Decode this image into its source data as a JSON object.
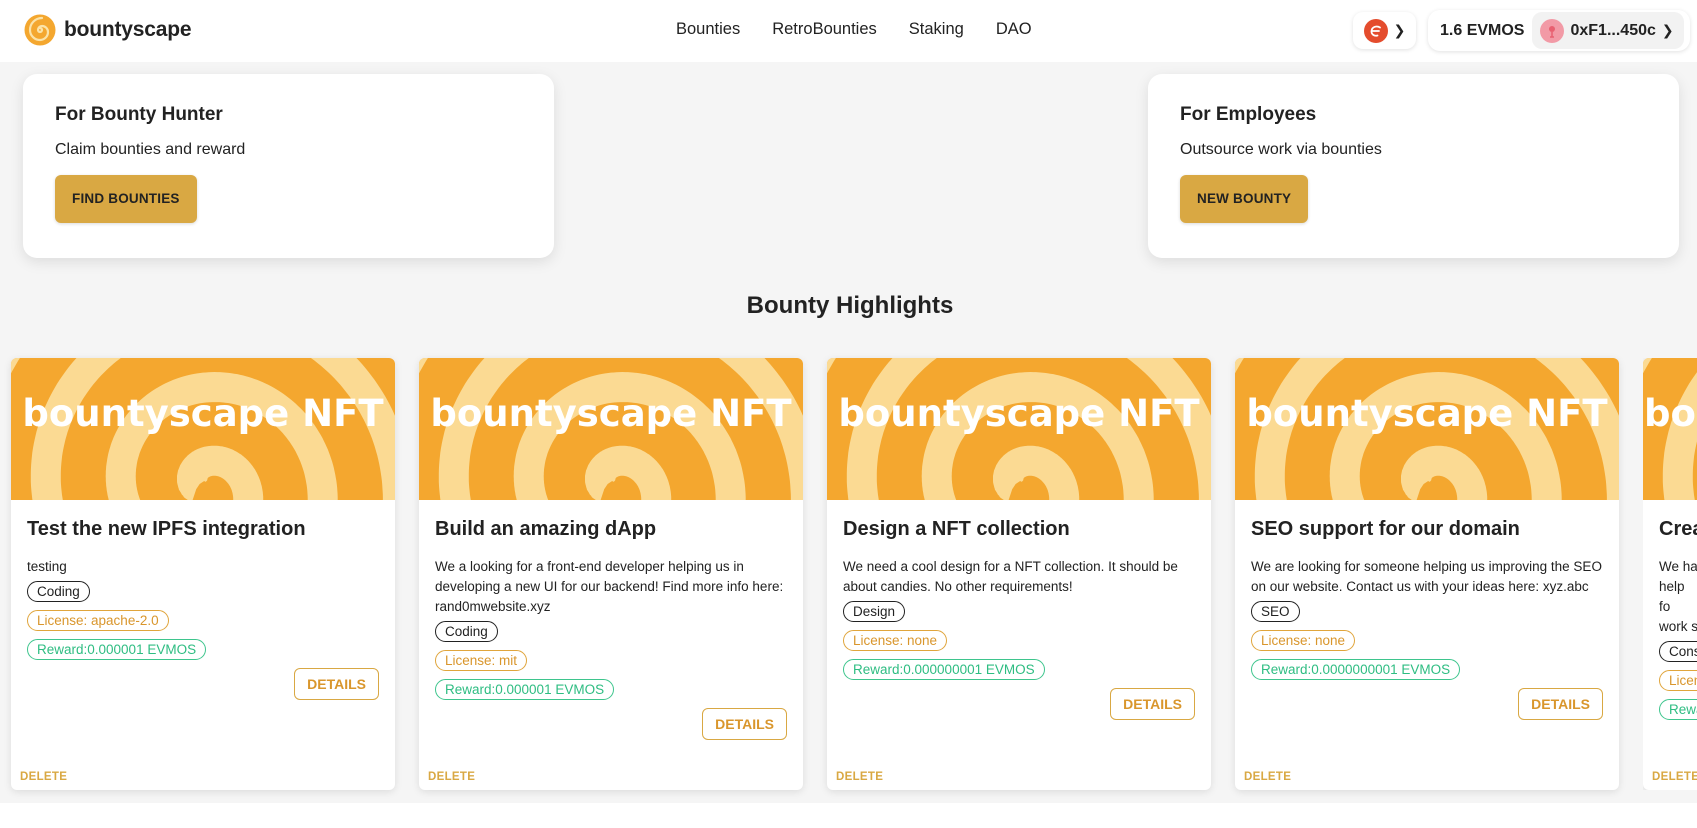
{
  "brand": {
    "name": "bountyscape"
  },
  "nav": [
    "Bounties",
    "RetroBounties",
    "Staking",
    "DAO"
  ],
  "wallet": {
    "balance": "1.6 EVMOS",
    "address": "0xF1...450c"
  },
  "hero": {
    "hunter": {
      "title": "For Bounty Hunter",
      "subtitle": "Claim bounties and reward",
      "button": "FIND BOUNTIES"
    },
    "employer": {
      "title": "For Employees",
      "subtitle": "Outsource work via bounties",
      "button": "NEW BOUNTY"
    }
  },
  "section_title": "Bounty Highlights",
  "banner_text": "bountyscape NFT",
  "details_label": "DETAILS",
  "delete_label": "DELETE",
  "cards": [
    {
      "title": "Test the new IPFS integration",
      "description": "testing",
      "category": "Coding",
      "license": "License: apache-2.0",
      "reward": "Reward:0.000001 EVMOS"
    },
    {
      "title": "Build an amazing dApp",
      "description": "We a looking for a front-end developer helping us in developing a new UI for our backend! Find more info here: rand0mwebsite.xyz",
      "category": "Coding",
      "license": "License: mit",
      "reward": "Reward:0.000001 EVMOS"
    },
    {
      "title": "Design a NFT collection",
      "description": "We need a cool design for a NFT collection. It should be about candies. No other requirements!",
      "category": "Design",
      "license": "License: none",
      "reward": "Reward:0.000000001 EVMOS"
    },
    {
      "title": "SEO support for our domain",
      "description": "We are looking for someone helping us improving the SEO on our website. Contact us with your ideas here: xyz.abc",
      "category": "SEO",
      "license": "License: none",
      "reward": "Reward:0.0000000001 EVMOS"
    },
    {
      "title": "Crea",
      "description": "We ha help fo work s",
      "category": "Cons",
      "license": "Licen",
      "reward": "Rewa"
    }
  ],
  "colors": {
    "accent": "#d9a843",
    "banner": "#f4a72f",
    "reward": "#2ebd82"
  }
}
